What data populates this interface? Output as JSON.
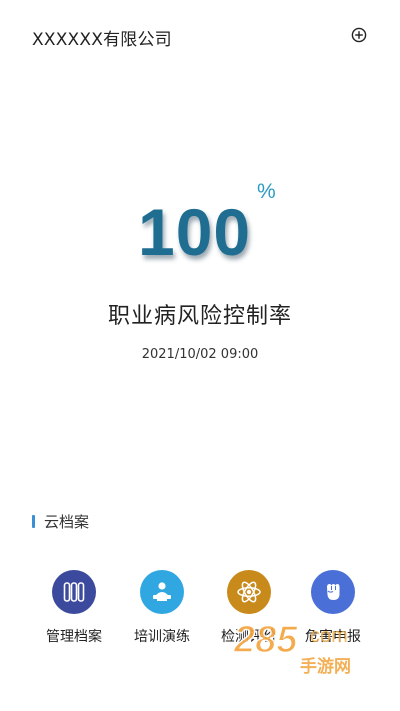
{
  "header": {
    "company": "XXXXXX有限公司",
    "add_icon": "plus-circle-icon"
  },
  "rate": {
    "value": "100",
    "unit": "%",
    "title": "职业病风险控制率",
    "timestamp": "2021/10/02 09:00"
  },
  "cloud_archive": {
    "section_title": "云档案",
    "items": [
      {
        "label": "管理档案",
        "icon": "archive-binders-icon",
        "color": "#3c4a9e"
      },
      {
        "label": "培训演练",
        "icon": "training-person-icon",
        "color": "#31a7e2"
      },
      {
        "label": "检测评价",
        "icon": "atom-icon",
        "color": "#c98a1c"
      },
      {
        "label": "危害申报",
        "icon": "fist-icon",
        "color": "#4a6fd6"
      }
    ]
  },
  "watermark": {
    "brand": "285",
    "suffix": "com",
    "subtitle": "手游网"
  },
  "colors": {
    "accent": "#1f6e92",
    "percent": "#2a9bc0",
    "section_bar": "#3a8fd6"
  }
}
